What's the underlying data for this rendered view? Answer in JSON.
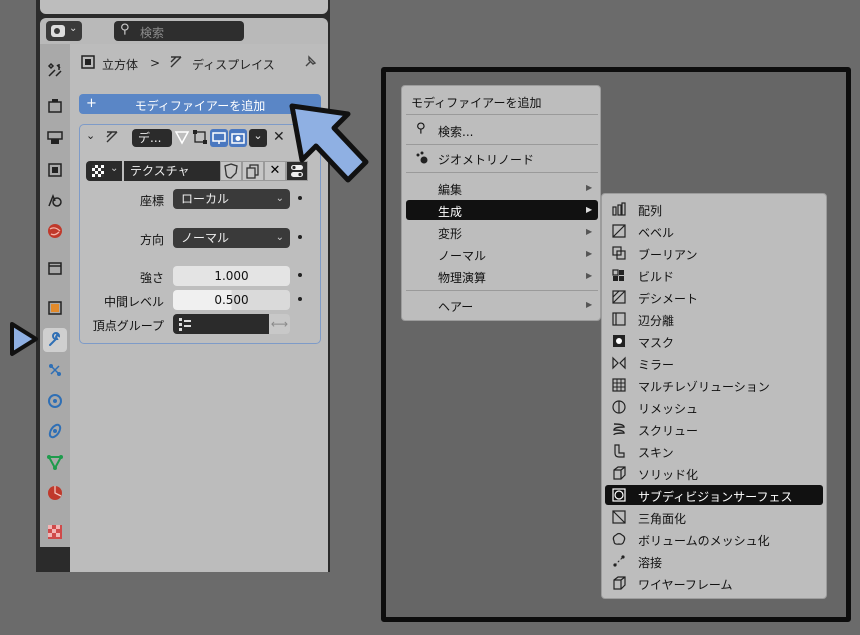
{
  "header": {
    "search_placeholder": "検索"
  },
  "breadcrumb": {
    "object": "立方体",
    "separator": ">",
    "modifier": "ディスプレイス"
  },
  "add_modifier_button": {
    "plus": "+",
    "label": "モディファイアーを追加"
  },
  "modifier": {
    "name": "デ...",
    "texture": "テクスチャ",
    "props": {
      "coords_label": "座標",
      "coords_value": "ローカル",
      "direction_label": "方向",
      "direction_value": "ノーマル",
      "strength_label": "強さ",
      "strength_value": "1.000",
      "midlevel_label": "中間レベル",
      "midlevel_value": "0.500",
      "vgroup_label": "頂点グループ"
    }
  },
  "menu": {
    "title": "モディファイアーを追加",
    "search": "検索...",
    "geo_nodes": "ジオメトリノード",
    "items": [
      "編集",
      "生成",
      "変形",
      "ノーマル",
      "物理演算"
    ],
    "hair": "ヘアー",
    "selected": "生成"
  },
  "submenu": {
    "items": [
      {
        "label": "配列",
        "icon": "array-icon"
      },
      {
        "label": "ベベル",
        "icon": "bevel-icon"
      },
      {
        "label": "ブーリアン",
        "icon": "boolean-icon"
      },
      {
        "label": "ビルド",
        "icon": "build-icon"
      },
      {
        "label": "デシメート",
        "icon": "decimate-icon"
      },
      {
        "label": "辺分離",
        "icon": "edge-split-icon"
      },
      {
        "label": "マスク",
        "icon": "mask-icon"
      },
      {
        "label": "ミラー",
        "icon": "mirror-icon"
      },
      {
        "label": "マルチレゾリューション",
        "icon": "multires-icon"
      },
      {
        "label": "リメッシュ",
        "icon": "remesh-icon"
      },
      {
        "label": "スクリュー",
        "icon": "screw-icon"
      },
      {
        "label": "スキン",
        "icon": "skin-icon"
      },
      {
        "label": "ソリッド化",
        "icon": "solidify-icon"
      },
      {
        "label": "サブディビジョンサーフェス",
        "icon": "subsurf-icon"
      },
      {
        "label": "三角面化",
        "icon": "triangulate-icon"
      },
      {
        "label": "ボリュームのメッシュ化",
        "icon": "volume-to-mesh-icon"
      },
      {
        "label": "溶接",
        "icon": "weld-icon"
      },
      {
        "label": "ワイヤーフレーム",
        "icon": "wireframe-icon"
      }
    ],
    "selected": "サブディビジョンサーフェス"
  },
  "colors": {
    "accent": "#5a86c6",
    "arrow": "#8fb0e3",
    "selection": "#111111",
    "panel": "#bcbcbc"
  }
}
